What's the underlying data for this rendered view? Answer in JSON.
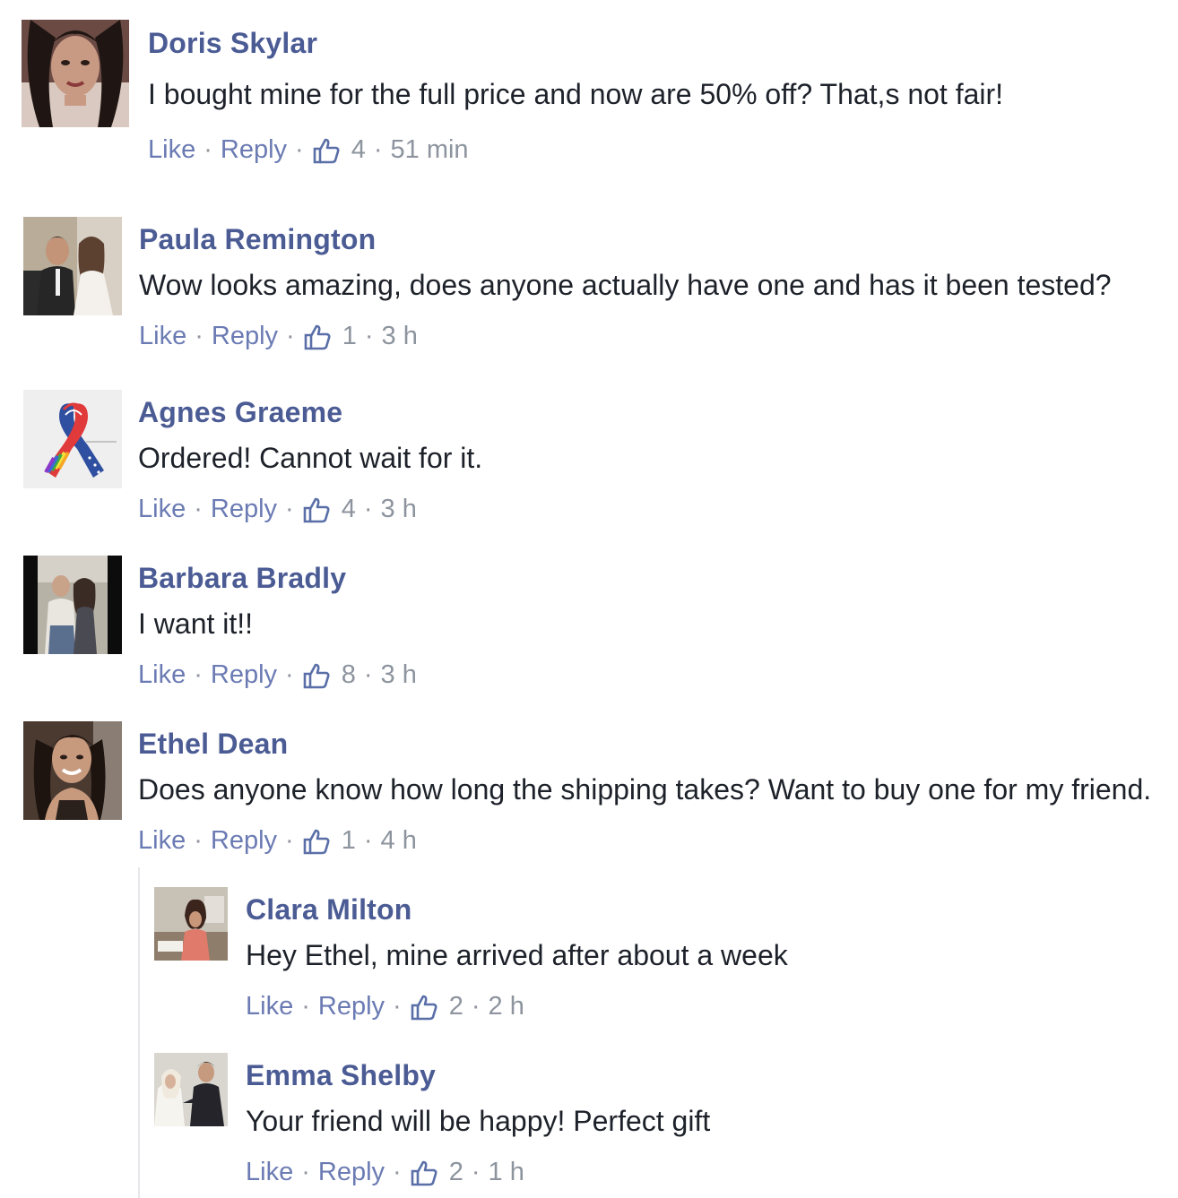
{
  "comments": [
    {
      "name": "Doris Skylar",
      "text": "I bought mine for the full price and now are 50% off? That,s not fair!",
      "like_label": "Like",
      "reply_label": "Reply",
      "likes": "4",
      "time": "51 min",
      "avatar_icon": "woman-portrait"
    },
    {
      "name": "Paula Remington",
      "text": "Wow looks amazing, does anyone actually have one and has it been tested?",
      "like_label": "Like",
      "reply_label": "Reply",
      "likes": "1",
      "time": "3 h",
      "avatar_icon": "wedding-couple-photo"
    },
    {
      "name": "Agnes Graeme",
      "text": "Ordered! Cannot wait for it.",
      "like_label": "Like",
      "reply_label": "Reply",
      "likes": "4",
      "time": "3 h",
      "avatar_icon": "ribbon-icon"
    },
    {
      "name": "Barbara Bradly",
      "text": "I want it!!",
      "like_label": "Like",
      "reply_label": "Reply",
      "likes": "8",
      "time": "3 h",
      "avatar_icon": "couple-photo"
    },
    {
      "name": "Ethel Dean",
      "text": "Does anyone know how long the shipping takes? Want to buy one for my friend.",
      "like_label": "Like",
      "reply_label": "Reply",
      "likes": "1",
      "time": "4 h",
      "avatar_icon": "woman-portrait"
    }
  ],
  "replies": [
    {
      "name": "Clara Milton",
      "text": "Hey Ethel, mine arrived after about a week",
      "like_label": "Like",
      "reply_label": "Reply",
      "likes": "2",
      "time": "2 h",
      "avatar_icon": "woman-at-desk-photo"
    },
    {
      "name": "Emma Shelby",
      "text": "Your friend will be happy! Perfect gift",
      "like_label": "Like",
      "reply_label": "Reply",
      "likes": "2",
      "time": "1 h",
      "avatar_icon": "wedding-couple-photo"
    }
  ],
  "colors": {
    "name": "#4b5b94",
    "text": "#1d2129",
    "meta": "#8d949e",
    "link": "#6b7bb3"
  }
}
